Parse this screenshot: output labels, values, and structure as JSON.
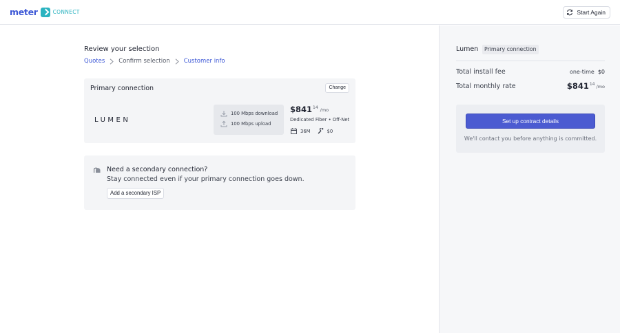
{
  "header": {
    "logo_word": "meter",
    "logo_sub": "CONNECT",
    "start_again_label": "Start Again"
  },
  "main": {
    "title": "Review your selection",
    "breadcrumb": [
      {
        "label": "Quotes",
        "state": "link"
      },
      {
        "label": "Confirm selection",
        "state": "current"
      },
      {
        "label": "Customer info",
        "state": "link"
      }
    ],
    "primary_card": {
      "title": "Primary connection",
      "change_label": "Change",
      "provider_logo_text": "LUMEN",
      "download": "100 Mbps download",
      "upload": "100 Mbps upload",
      "price_dollars": "$841",
      "price_cents": "14",
      "price_per": "/mo",
      "service": "Dedicated Fiber • Off-Net",
      "term": "36M",
      "install": "$0"
    },
    "secondary_card": {
      "title": "Need a secondary connection?",
      "subtitle": "Stay connected even if your primary connection goes down.",
      "button_label": "Add a secondary ISP"
    }
  },
  "sidebar": {
    "provider": "Lumen",
    "tag": "Primary connection",
    "install_label": "Total install fee",
    "install_prefix": "one-time",
    "install_amount": "$0",
    "monthly_label": "Total monthly rate",
    "monthly_dollars": "$841",
    "monthly_cents": "14",
    "monthly_per": "/mo",
    "cta_label": "Set up contract details",
    "cta_note": "We'll contact you before anything is committed."
  },
  "colors": {
    "brand_blue": "#3d58d6",
    "brand_teal": "#2bb3c0",
    "cta": "#4b5bd1"
  }
}
